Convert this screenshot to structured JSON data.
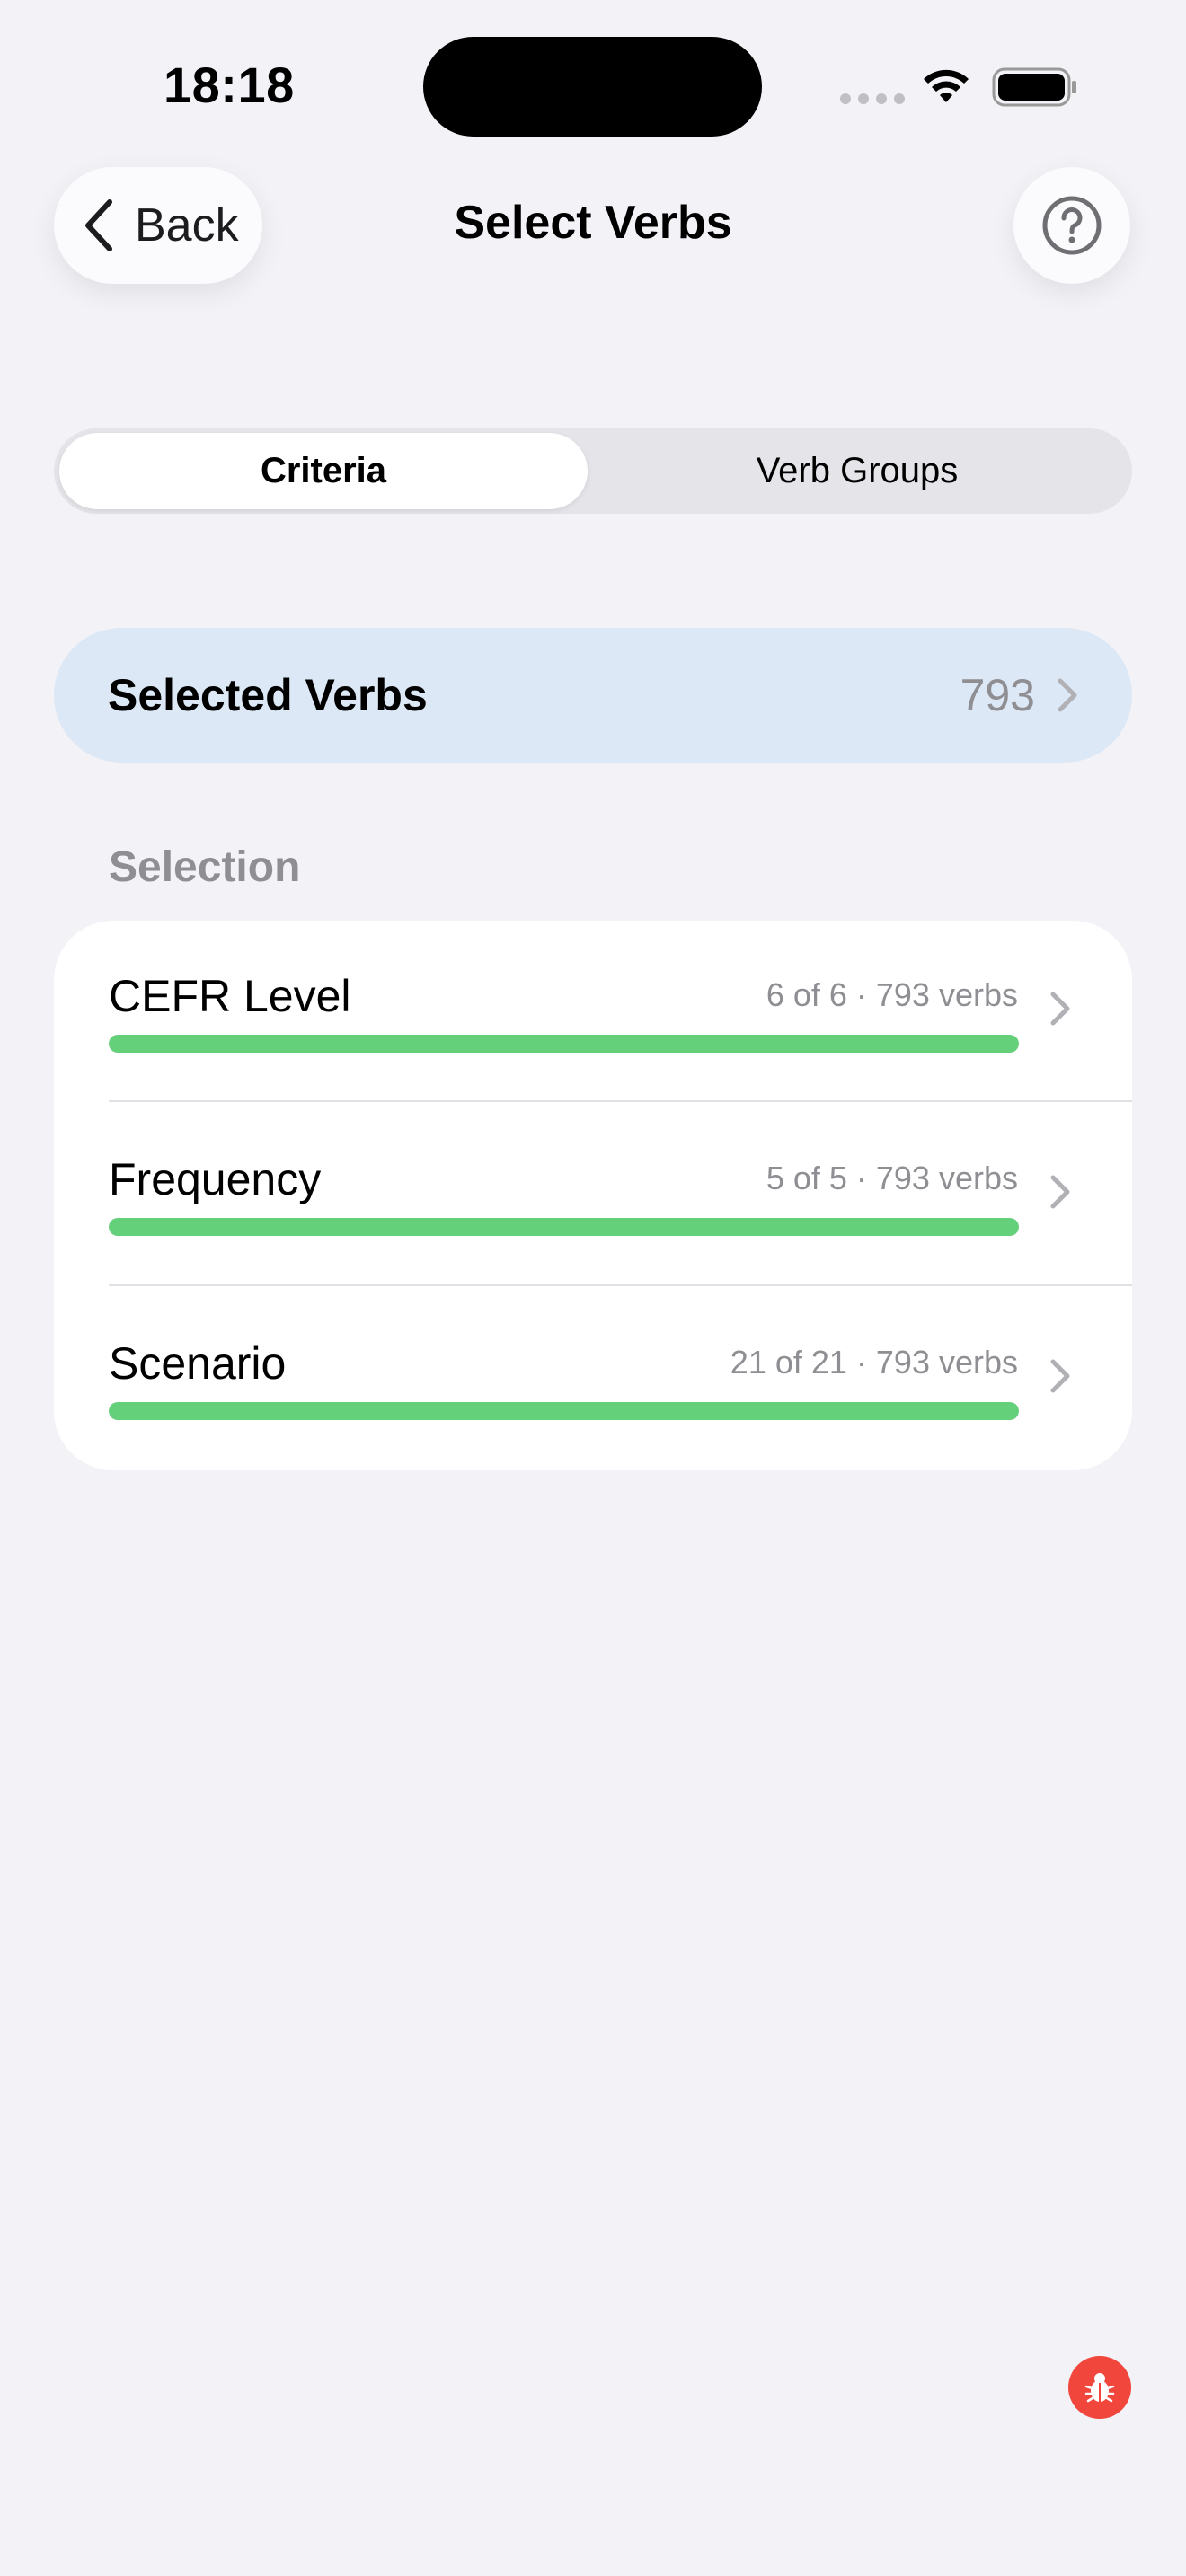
{
  "status_bar": {
    "time": "18:18"
  },
  "nav": {
    "back_label": "Back",
    "title": "Select Verbs",
    "help_icon": "question-circle-icon"
  },
  "segments": {
    "items": [
      {
        "label": "Criteria",
        "selected": true
      },
      {
        "label": "Verb Groups",
        "selected": false
      }
    ]
  },
  "selected_verbs": {
    "label": "Selected Verbs",
    "count": "793"
  },
  "selection": {
    "header": "Selection",
    "rows": [
      {
        "label": "CEFR Level",
        "meta": "6 of 6  ·  793 verbs",
        "progress": 1.0
      },
      {
        "label": "Frequency",
        "meta": "5 of 5  ·  793 verbs",
        "progress": 1.0
      },
      {
        "label": "Scenario",
        "meta": "21 of 21  ·  793 verbs",
        "progress": 1.0
      }
    ]
  },
  "colors": {
    "background": "#f2f2f7",
    "accent_row": "#dde8f6",
    "progress": "#65d07a",
    "debug": "#f0463c"
  },
  "debug": {
    "icon": "bug-icon"
  }
}
